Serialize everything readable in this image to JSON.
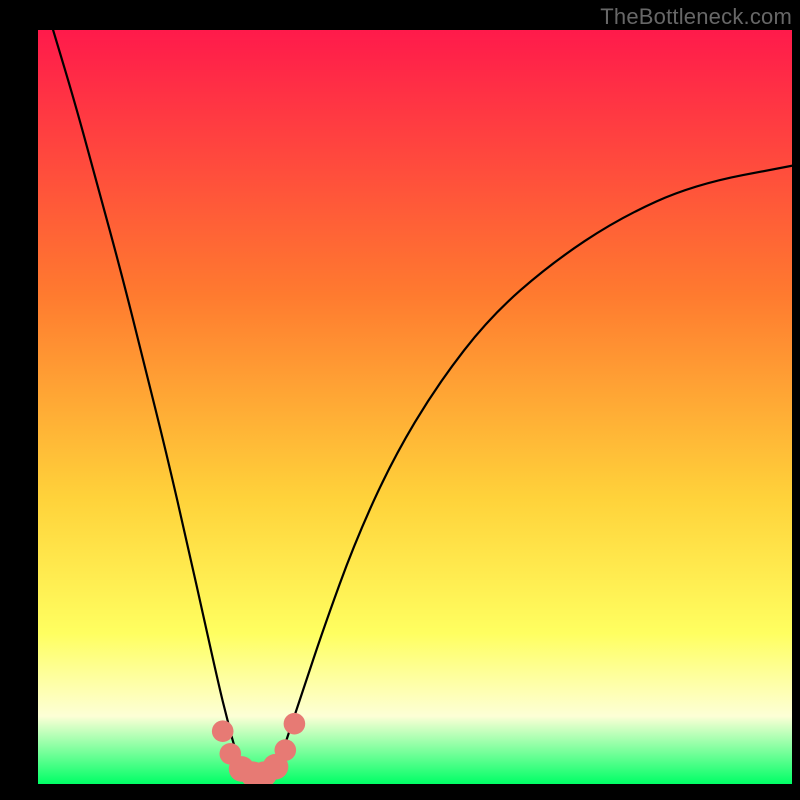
{
  "watermark": "TheBottleneck.com",
  "colors": {
    "gradient_top": "#ff1a4b",
    "gradient_mid1": "#ff7a2f",
    "gradient_mid2": "#ffd23a",
    "gradient_mid3": "#ffff60",
    "gradient_pale": "#fdffd6",
    "gradient_bottom": "#00ff66",
    "curve": "#000000",
    "marker_fill": "#e77a74",
    "marker_stroke": "#c95b55",
    "frame": "#000000"
  },
  "chart_data": {
    "type": "line",
    "title": "",
    "xlabel": "",
    "ylabel": "",
    "xlim": [
      0,
      100
    ],
    "ylim": [
      0,
      100
    ],
    "grid": false,
    "legend": false,
    "background": "vertical-gradient",
    "series": [
      {
        "name": "bottleneck-curve",
        "x": [
          2,
          5,
          8,
          11,
          14,
          17,
          20,
          22,
          24,
          25,
          26,
          27,
          28,
          29,
          30,
          31,
          32,
          33,
          35,
          38,
          42,
          47,
          53,
          60,
          68,
          77,
          87,
          100
        ],
        "y": [
          100,
          90,
          79,
          68,
          56,
          44,
          31,
          22,
          13,
          9,
          5,
          2.5,
          1.5,
          1,
          1,
          1.5,
          3,
          6,
          12,
          21,
          32,
          43,
          53,
          62,
          69,
          75,
          79.5,
          82
        ]
      }
    ],
    "markers": [
      {
        "x": 24.5,
        "y": 7,
        "r": 1.0
      },
      {
        "x": 25.5,
        "y": 4,
        "r": 1.0
      },
      {
        "x": 27.0,
        "y": 2,
        "r": 1.3
      },
      {
        "x": 28.5,
        "y": 1.3,
        "r": 1.3
      },
      {
        "x": 30.0,
        "y": 1.3,
        "r": 1.3
      },
      {
        "x": 31.5,
        "y": 2.3,
        "r": 1.3
      },
      {
        "x": 32.8,
        "y": 4.5,
        "r": 1.0
      },
      {
        "x": 34.0,
        "y": 8,
        "r": 1.0
      }
    ],
    "optimum_x": 29
  }
}
